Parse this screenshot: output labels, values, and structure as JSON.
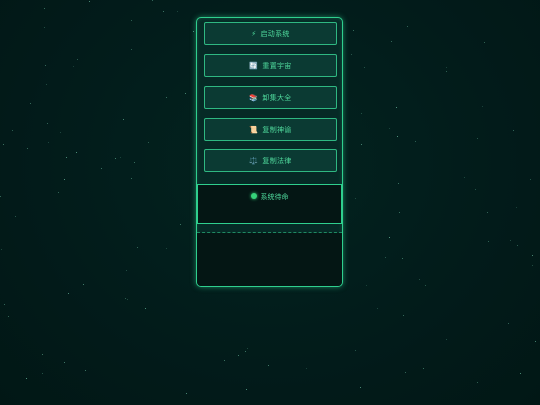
{
  "menu": {
    "items": [
      {
        "icon": "⚡",
        "icon_name": "lightning-icon",
        "label": "启动系统"
      },
      {
        "icon": "🔄",
        "icon_name": "refresh-icon",
        "label": "重置宇宙"
      },
      {
        "icon": "📚",
        "icon_name": "books-icon",
        "label": "卸集大全"
      },
      {
        "icon": "📜",
        "icon_name": "scroll-icon",
        "label": "复制神谕"
      },
      {
        "icon": "⚖️",
        "icon_name": "scales-icon",
        "label": "复制法律"
      }
    ]
  },
  "status": {
    "label": "系统待命",
    "icon_name": "status-dot-icon",
    "color": "#36d27a"
  },
  "colors": {
    "background": "#021c1b",
    "accent": "#2fcf8e",
    "text": "#4fd99c"
  }
}
